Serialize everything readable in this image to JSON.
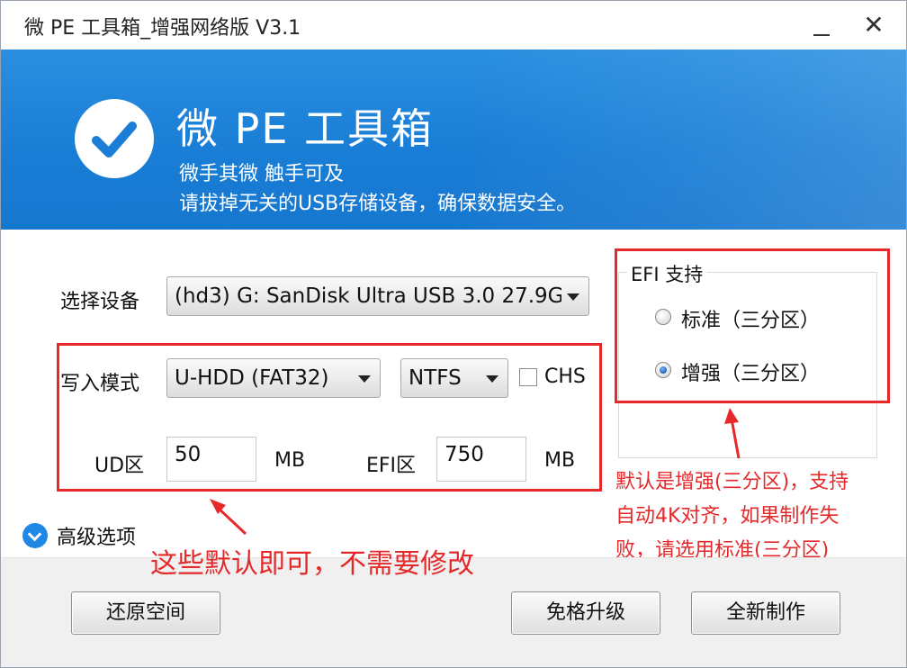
{
  "window": {
    "title": "微 PE 工具箱_增强网络版 V3.1",
    "minimize_icon": "minimize-icon",
    "close_glyph": "✕"
  },
  "banner": {
    "logo_icon": "checkmark-icon",
    "brand": "微 PE 工具箱",
    "slogan": "微手其微 触手可及",
    "hint": "请拔掉无关的USB存储设备，确保数据安全。"
  },
  "form": {
    "device_label": "选择设备",
    "device_value": "(hd3) G: SanDisk Ultra USB 3.0 27.9G",
    "mode_label": "写入模式",
    "mode_value": "U-HDD (FAT32)",
    "fs_value": "NTFS",
    "chs_label": "CHS",
    "chs_checked": false,
    "ud_label": "UD区",
    "ud_value": "50",
    "ud_unit": "MB",
    "efi_label": "EFI区",
    "efi_value": "750",
    "efi_unit": "MB"
  },
  "efi_support": {
    "legend": "EFI 支持",
    "options": [
      {
        "label": "标准（三分区）",
        "selected": false
      },
      {
        "label": "增强（三分区）",
        "selected": true
      }
    ]
  },
  "advanced": {
    "icon": "chevron-down-circle-icon",
    "label": "高级选项"
  },
  "buttons": {
    "restore": "还原空间",
    "upgrade": "免格升级",
    "create": "全新制作"
  },
  "annotations": {
    "note_defaults": "这些默认即可，不需要修改",
    "note_efi_lines": [
      "默认是增强(三分区)，支持",
      "自动4K对齐，如果制作失",
      "败，请选用标准(三分区)"
    ]
  },
  "colors": {
    "banner_blue": "#1a7ed6",
    "annotation_red": "#e5292b",
    "advanced_icon_blue": "#1f88e5"
  }
}
